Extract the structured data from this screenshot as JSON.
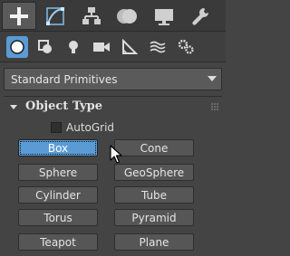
{
  "command_tabs": [
    {
      "name": "create-tab",
      "icon": "plus-icon",
      "active": true
    },
    {
      "name": "modify-tab",
      "icon": "modify-curve-icon"
    },
    {
      "name": "hierarchy-tab",
      "icon": "hierarchy-icon"
    },
    {
      "name": "motion-tab",
      "icon": "motion-icon"
    },
    {
      "name": "display-tab",
      "icon": "display-monitor-icon"
    },
    {
      "name": "utilities-tab",
      "icon": "wrench-icon"
    }
  ],
  "categories": [
    {
      "name": "geometry",
      "icon": "sphere-icon",
      "active": true
    },
    {
      "name": "shapes",
      "icon": "shapes-icon"
    },
    {
      "name": "lights",
      "icon": "lightbulb-icon"
    },
    {
      "name": "cameras",
      "icon": "camera-icon"
    },
    {
      "name": "helpers",
      "icon": "helper-ruler-icon"
    },
    {
      "name": "space-warps",
      "icon": "wave-icon"
    },
    {
      "name": "systems",
      "icon": "gears-icon"
    }
  ],
  "dropdown": {
    "value": "Standard Primitives"
  },
  "rollout": {
    "title": "Object Type",
    "autogrid_label": "AutoGrid",
    "autogrid_checked": false
  },
  "buttons": {
    "box": "Box",
    "cone": "Cone",
    "sphere": "Sphere",
    "geosphere": "GeoSphere",
    "cylinder": "Cylinder",
    "tube": "Tube",
    "torus": "Torus",
    "pyramid": "Pyramid",
    "teapot": "Teapot",
    "plane": "Plane"
  },
  "colors": {
    "accent": "#5b9bd5",
    "panel": "#444444",
    "button": "#565656"
  }
}
